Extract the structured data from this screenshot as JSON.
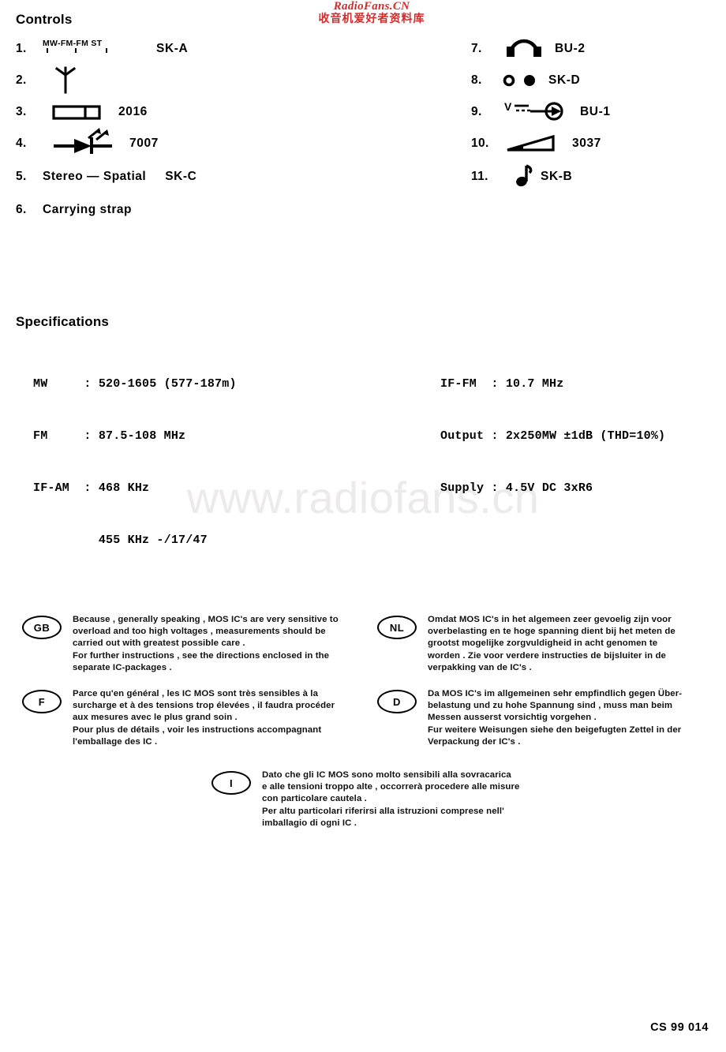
{
  "watermarks": {
    "top_latin": "RadioFans.CN",
    "top_cjk": "收音机爱好者资料库",
    "center": "www.radiofans.cn",
    "color_red": "#d32b2b",
    "color_gray": "#eceaea"
  },
  "controls": {
    "heading": "Controls",
    "left_items": [
      {
        "num": "1.",
        "symbol": "slide-switch-mw-fm-fmst",
        "sw_labels": "MW-FM-FM ST",
        "sw_mw": "MW",
        "sw_fm": "FM",
        "sw_fmst": "FM",
        "sw_st": "ST",
        "label": "SK-A"
      },
      {
        "num": "2.",
        "symbol": "antenna",
        "label": ""
      },
      {
        "num": "3.",
        "symbol": "tuning-scale-rectangle",
        "label": "2016"
      },
      {
        "num": "4.",
        "symbol": "led-diode",
        "label": "7007"
      },
      {
        "num": "5.",
        "symbol": "none",
        "text": "Stereo — Spatial",
        "label": "SK-C"
      },
      {
        "num": "6.",
        "symbol": "none",
        "text": "Carrying  strap",
        "label": ""
      }
    ],
    "right_items": [
      {
        "num": "7.",
        "symbol": "headphones",
        "label": "BU-2"
      },
      {
        "num": "8.",
        "symbol": "power-on-off",
        "label": "SK-D"
      },
      {
        "num": "9.",
        "symbol": "dc-power-jack",
        "sym_text": "V",
        "label": "BU-1"
      },
      {
        "num": "10.",
        "symbol": "volume-wedge",
        "label": "3037"
      },
      {
        "num": "11.",
        "symbol": "music-note",
        "label": "SK-B"
      }
    ]
  },
  "specifications": {
    "heading": "Specifications",
    "left_lines": [
      "MW     : 520-1605 (577-187m)",
      "FM     : 87.5-108 MHz",
      "IF-AM  : 468 KHz",
      "         455 KHz -/17/47"
    ],
    "right_lines": [
      "IF-FM  : 10.7 MHz",
      "Output : 2x250MW ±1dB (THD=10%)",
      "Supply : 4.5V DC 3xR6"
    ]
  },
  "language_notes": [
    {
      "code": "GB",
      "lines": [
        "Because , generally  speaking , MOS  IC's  are  very  sensitive  to",
        "overload  and  too  high  voltages , measurements  should   be",
        "carried   out  with  greatest  possible  care .",
        "For  further  instructions , see  the  directions  enclosed  in  the",
        "separate  IC-packages ."
      ]
    },
    {
      "code": "NL",
      "lines": [
        "Omdat  MOS  IC's  in  het  algemeen  zeer  gevoelig  zijn  voor",
        "overbelasting  en  te  hoge  spanning  dient  bij  het  meten  de",
        "grootst  mogelijke  zorgvuldigheid  in  acht  genomen  te",
        "worden . Zie  voor  verdere  instructies  de  bijsluiter  in   de",
        "verpakking  van  de  IC's ."
      ]
    },
    {
      "code": "F",
      "lines": [
        "Parce  qu'en  général , les  IC  MOS  sont  très  sensibles  à  la",
        "surcharge  et  à  des  tensions  trop  élevées , il  faudra  procéder",
        "aux  mesures  avec  le  plus   grand  soin .",
        "Pour  plus  de  détails , voir  les  instructions  accompagnant",
        "l'emballage  des  IC ."
      ]
    },
    {
      "code": "D",
      "lines": [
        "Da  MOS  IC's  im  allgemeinen  sehr  empfindlich  gegen  Über-",
        "belastung  und  zu  hohe  Spannung  sind , muss  man  beim",
        "Messen  ausserst  vorsichtig  vorgehen .",
        "Fur  weitere  Weisungen  siehe  den  beigefugten  Zettel  in  der",
        "Verpackung  der  IC's ."
      ]
    },
    {
      "code": "I",
      "lines": [
        "Dato  che  gli  IC  MOS  sono  molto  sensibili  alla  sovracarica",
        "e  alle  tensioni   troppo  alte , occorrerà  procedere  alle  misure",
        "con  particolare   cautela .",
        "Per  altu  particolari  riferirsi  alla  istruzioni  comprese  nell'",
        "imballagio  di  ogni  IC ."
      ]
    }
  ],
  "footer": {
    "code": "CS 99 014"
  }
}
